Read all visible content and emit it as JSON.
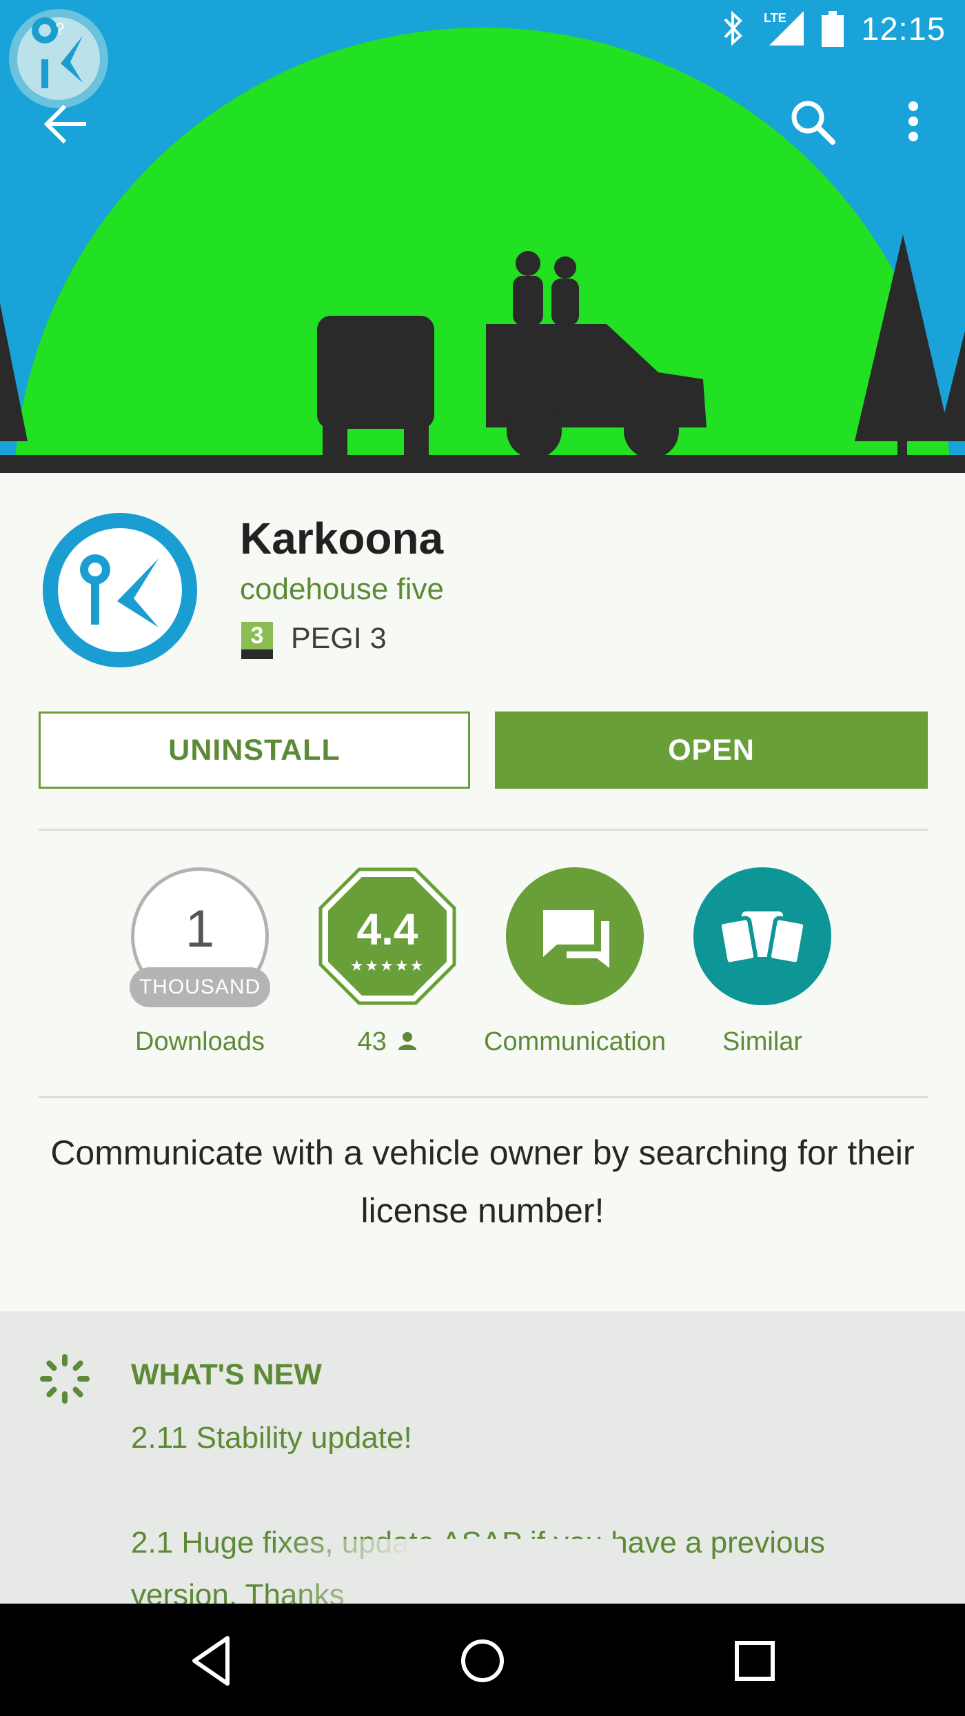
{
  "status_bar": {
    "time": "12:15",
    "network": "LTE",
    "icons": [
      "bluetooth-icon",
      "signal-icon",
      "battery-icon"
    ]
  },
  "toolbar": {
    "icons": [
      "back-arrow-icon",
      "search-icon",
      "more-vert-icon"
    ]
  },
  "colors": {
    "accent": "#689f38",
    "accent_text": "#5d8a36",
    "hero_sky": "#1aa3d9",
    "hero_sun": "#22e022",
    "app_icon_ring": "#1a9ed1",
    "similar": "#0e9696"
  },
  "app": {
    "title": "Karkoona",
    "developer": "codehouse five",
    "pegi_number": "3",
    "pegi_label": "PEGI 3"
  },
  "actions": {
    "uninstall": "UNINSTALL",
    "open": "OPEN"
  },
  "stats": {
    "downloads_number": "1",
    "downloads_unit": "THOUSAND",
    "downloads_label": "Downloads",
    "rating": "4.4",
    "rating_stars": 4.4,
    "rating_count": "43",
    "category_label": "Communication",
    "similar_label": "Similar"
  },
  "description": "Communicate with a vehicle owner by searching for their license number!",
  "whats_new": {
    "title": "WHAT'S NEW",
    "body": "2.11 Stability update!\n\n2.1 Huge fixes, update ASAP if you have a previous version. Thanks"
  },
  "nav_bar": {
    "icons": [
      "back-triangle-icon",
      "home-circle-icon",
      "recents-square-icon"
    ]
  }
}
